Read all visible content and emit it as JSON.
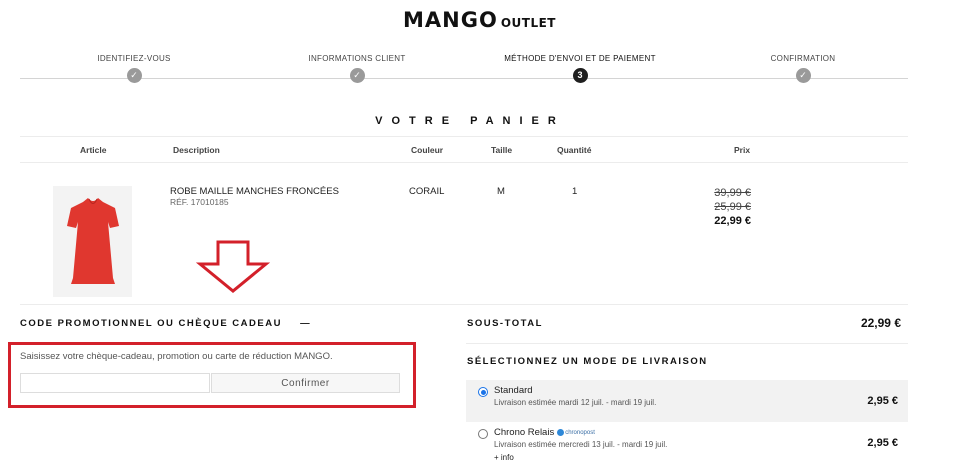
{
  "header": {
    "brand": "MANGO",
    "sub_brand": "OUTLET"
  },
  "steps": [
    {
      "label": "IDENTIFIEZ-VOUS",
      "state": "done",
      "mark": "✓"
    },
    {
      "label": "INFORMATIONS CLIENT",
      "state": "done",
      "mark": "✓"
    },
    {
      "label": "MÉTHODE D'ENVOI ET DE PAIEMENT",
      "state": "current",
      "mark": "3"
    },
    {
      "label": "CONFIRMATION",
      "state": "todo",
      "mark": "✓"
    }
  ],
  "cart": {
    "title": "VOTRE PANIER",
    "columns": {
      "article": "Article",
      "description": "Description",
      "color": "Couleur",
      "size": "Taille",
      "quantity": "Quantité",
      "price": "Prix"
    },
    "item": {
      "name": "ROBE MAILLE MANCHES FRONCÉES",
      "ref": "RÉF. 17010185",
      "color": "CORAIL",
      "size": "M",
      "quantity": "1",
      "price_original": "39,99 €",
      "price_previous": "25,99 €",
      "price_final": "22,99 €",
      "image_color": "#e0372f"
    }
  },
  "promo": {
    "title": "CODE PROMOTIONNEL OU CHÈQUE CADEAU",
    "toggle": "—",
    "instructions": "Saisissez votre chèque-cadeau, promotion ou carte de réduction MANGO.",
    "input_value": "",
    "input_placeholder": "",
    "confirm_label": "Confirmer",
    "highlight_color": "#d3202a"
  },
  "summary": {
    "subtotal_label": "SOUS-TOTAL",
    "subtotal_value": "22,99 €"
  },
  "delivery": {
    "title": "SÉLECTIONNEZ UN MODE DE LIVRAISON",
    "options": [
      {
        "name": "Standard",
        "date": "Livraison estimée mardi 12 juil. - mardi 19 juil.",
        "price": "2,95 €",
        "selected": true,
        "more": ""
      },
      {
        "name": "Chrono Relais",
        "carrier": "chronopost",
        "date": "Livraison estimée mercredi 13 juil. - mardi 19 juil.",
        "price": "2,95 €",
        "selected": false,
        "more": "+ info"
      }
    ]
  },
  "icons": {
    "arrow": "down-arrow-icon",
    "check": "check-icon"
  },
  "colors": {
    "accent": "#1a73e8",
    "dark": "#1f1f1f",
    "step_done": "#9a9a9a"
  }
}
